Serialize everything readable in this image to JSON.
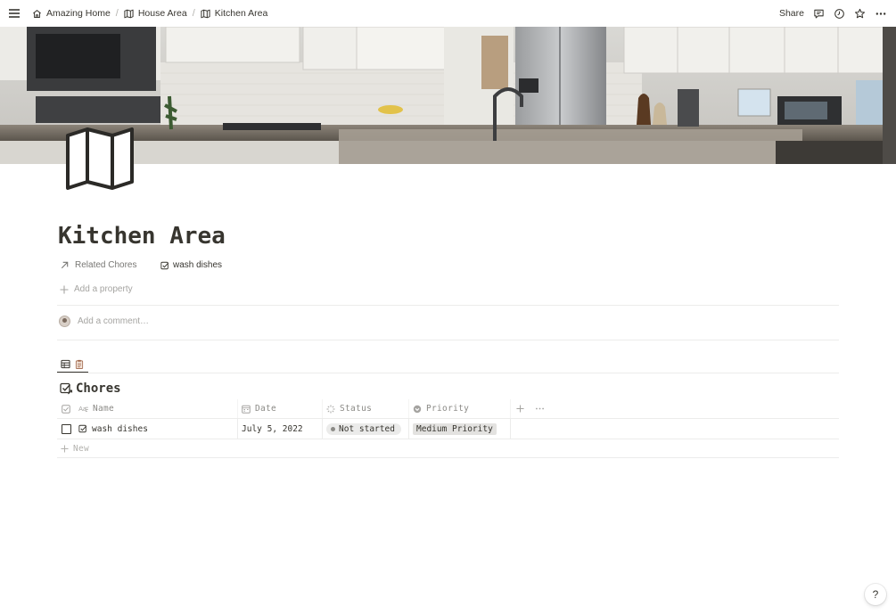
{
  "breadcrumbs": [
    {
      "label": "Amazing Home",
      "icon": "home-icon"
    },
    {
      "label": "House Area",
      "icon": "map-icon"
    },
    {
      "label": "Kitchen Area",
      "icon": "map-icon"
    }
  ],
  "topbar": {
    "share_label": "Share",
    "icons": [
      "comment-icon",
      "clock-icon",
      "star-icon",
      "more-icon"
    ]
  },
  "cover": {
    "description_icon": "kitchen-cover-image"
  },
  "page": {
    "icon": "map-icon",
    "title": "Kitchen Area"
  },
  "properties": [
    {
      "name": "Related Chores",
      "icon": "arrow-up-right-icon",
      "value": "wash dishes",
      "value_icon": "checkbox-icon"
    }
  ],
  "add_property_label": "Add a property",
  "comment": {
    "placeholder": "Add a comment…"
  },
  "database": {
    "title": "Chores",
    "columns": [
      {
        "label": "Name",
        "icon": "text-icon"
      },
      {
        "label": "Date",
        "icon": "calendar-icon"
      },
      {
        "label": "Status",
        "icon": "status-icon"
      },
      {
        "label": "Priority",
        "icon": "select-icon"
      }
    ],
    "rows": [
      {
        "name": "wash dishes",
        "date": "July 5, 2022",
        "status": "Not started",
        "priority": "Medium Priority"
      }
    ],
    "new_label": "New"
  },
  "help_label": "?"
}
